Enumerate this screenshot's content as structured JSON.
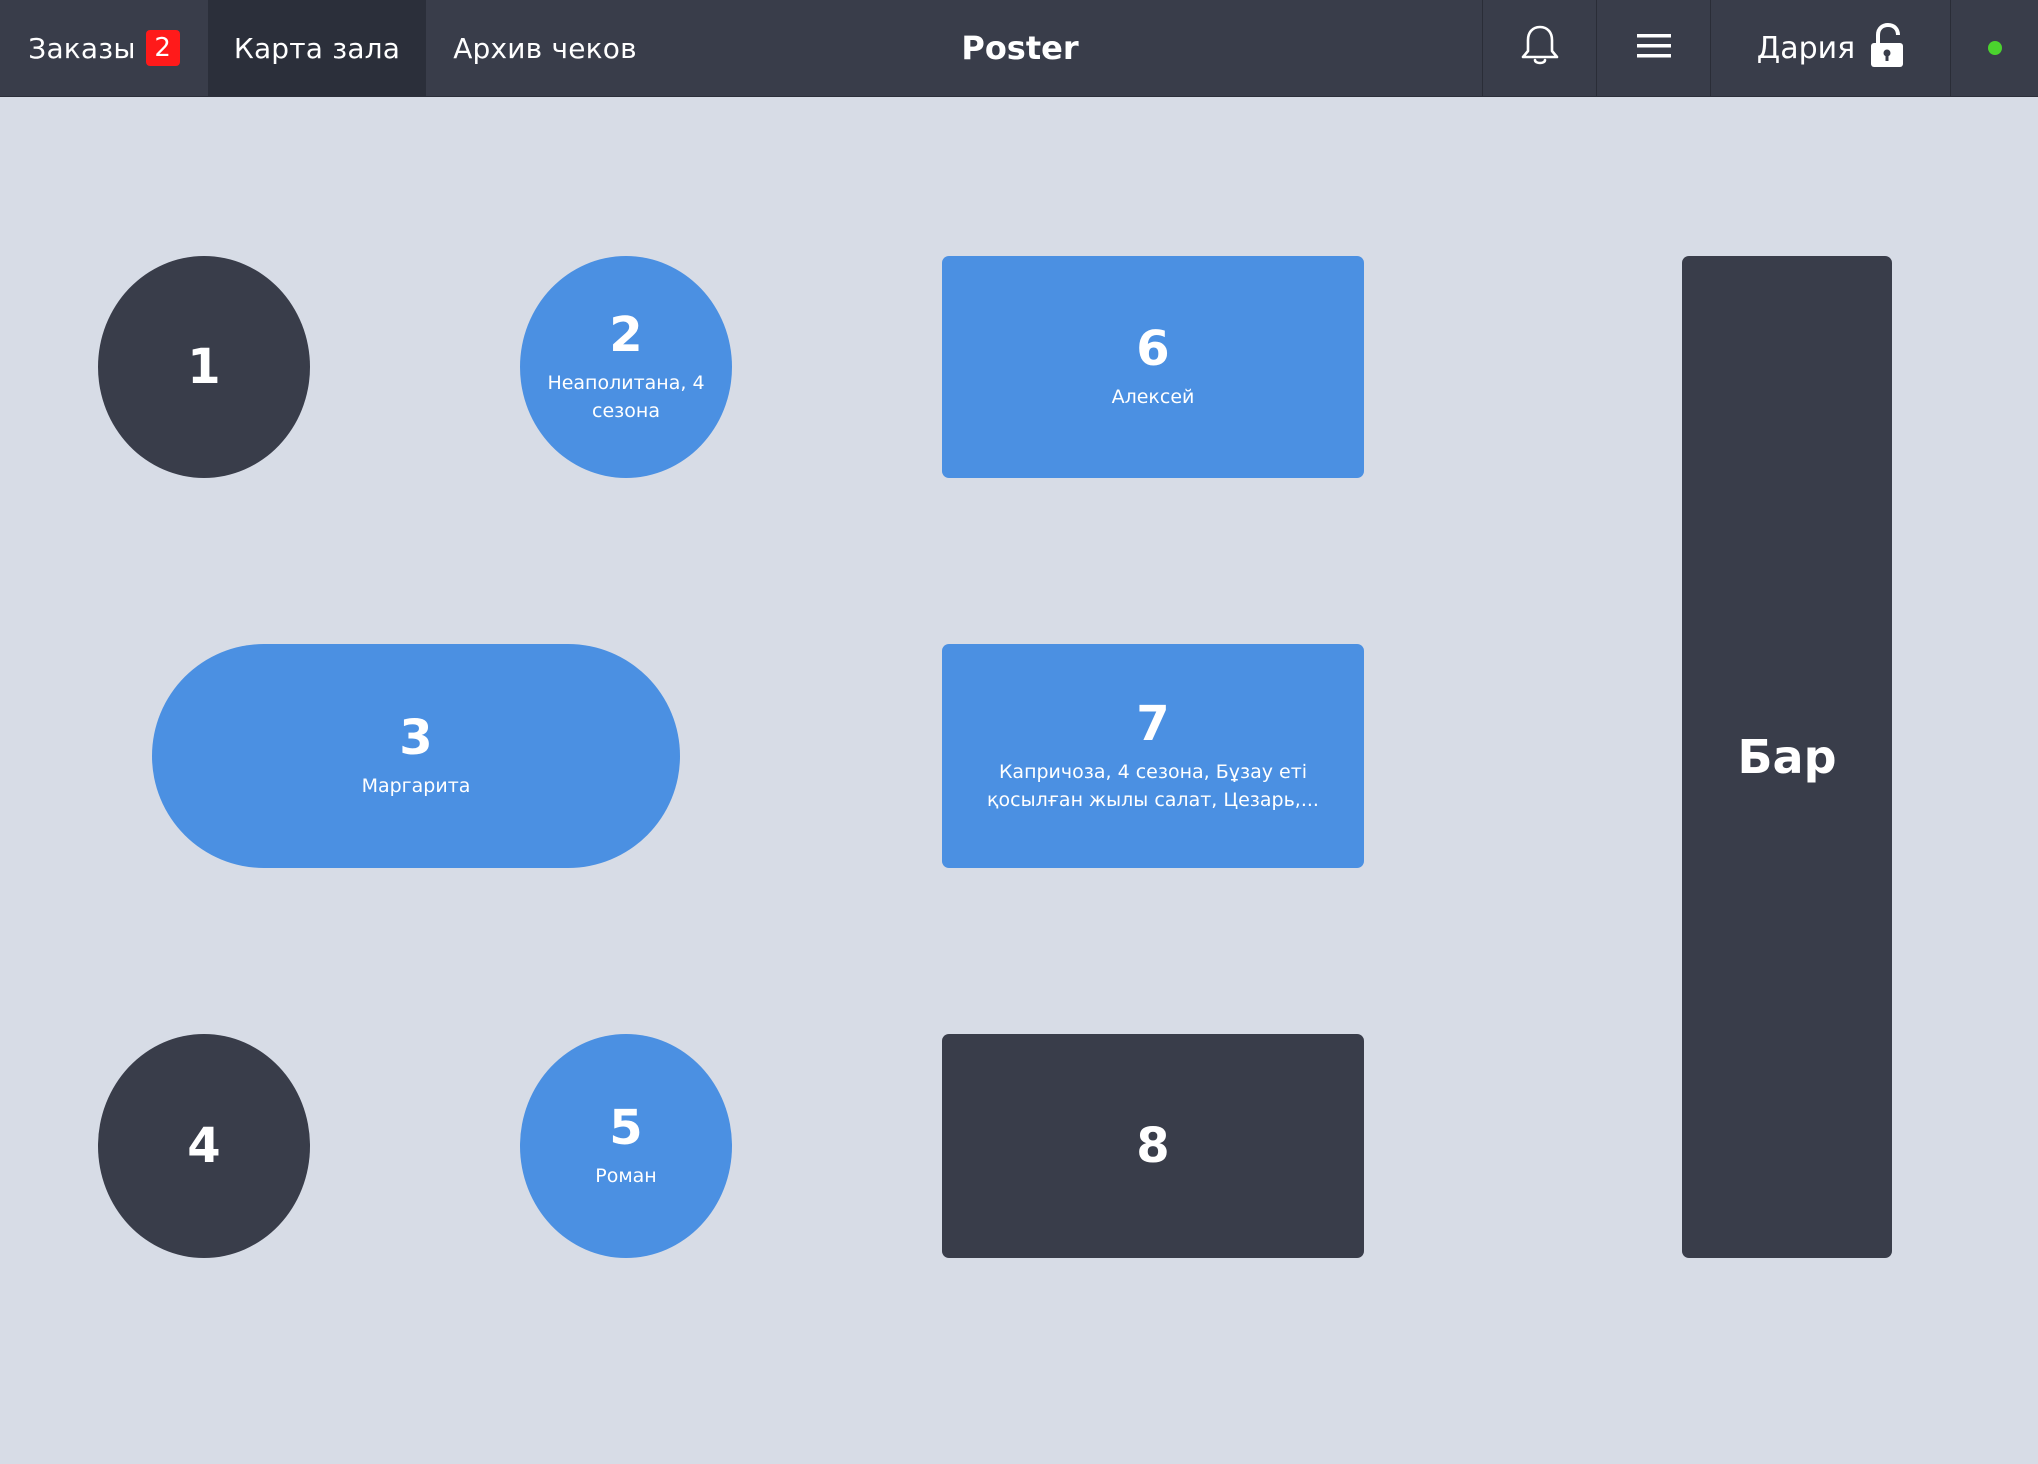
{
  "topbar": {
    "tabs": [
      {
        "label": "Заказы",
        "badge": "2"
      },
      {
        "label": "Карта зала"
      },
      {
        "label": "Архив чеков"
      }
    ],
    "brand": "Poster",
    "user": "Дария"
  },
  "hall": {
    "tables": [
      {
        "number": "1",
        "subtitle": ""
      },
      {
        "number": "2",
        "subtitle": "Неаполитана, 4 сезона"
      },
      {
        "number": "3",
        "subtitle": "Маргарита"
      },
      {
        "number": "4",
        "subtitle": ""
      },
      {
        "number": "5",
        "subtitle": "Роман"
      },
      {
        "number": "6",
        "subtitle": "Алексей"
      },
      {
        "number": "7",
        "subtitle": "Капричоза, 4 сезона, Бұзау еті қосылған жылы салат, Цезарь,..."
      },
      {
        "number": "8",
        "subtitle": ""
      }
    ],
    "bar_label": "Бар"
  },
  "colors": {
    "topbar": "#393d4a",
    "background": "#d7dce6",
    "table_free": "#393d4a",
    "table_busy": "#4b90e2",
    "badge": "#ff1a1a",
    "status_online": "#4bd32e"
  },
  "icons": [
    "bell-icon",
    "menu-icon",
    "unlock-icon",
    "status-dot"
  ]
}
